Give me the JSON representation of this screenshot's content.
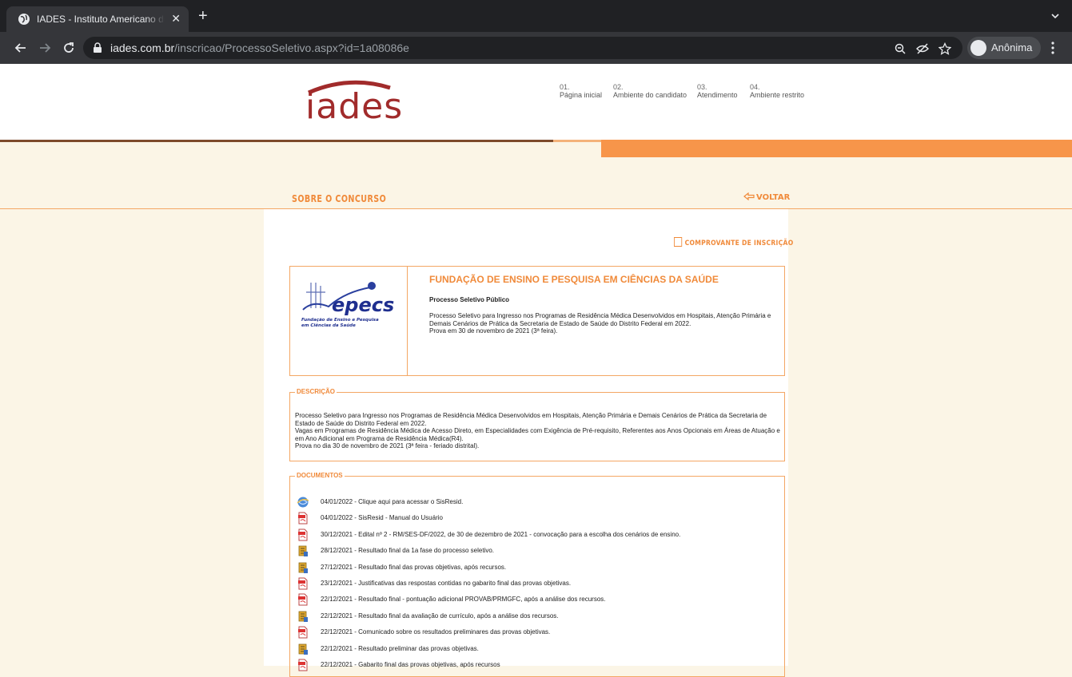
{
  "browser": {
    "tab_title": "IADES - Instituto Americano de",
    "url_domain": "iades.com.br",
    "url_path": "/inscricao/ProcessoSeletivo.aspx?id=1a08086e",
    "profile_name": "Anônima"
  },
  "site": {
    "logo_text": "iades",
    "nav": [
      {
        "num": "01.",
        "label": "Página inicial"
      },
      {
        "num": "02.",
        "label": "Ambiente do candidato"
      },
      {
        "num": "03.",
        "label": "Atendimento"
      },
      {
        "num": "04.",
        "label": "Ambiente restrito"
      }
    ],
    "section_title": "SOBRE O CONCURSO",
    "back_label": "VOLTAR",
    "comprovante_label": "COMPROVANTE DE INSCRIÇÃO"
  },
  "organization": {
    "logo_text": "epecs",
    "logo_subtitle": "Fundação de Ensino e Pesquisa em Ciências da Saúde",
    "title": "FUNDAÇÃO DE ENSINO E PESQUISA EM CIÊNCIAS DA SAÚDE",
    "process_type": "Processo Seletivo Público",
    "process_description": "Processo Seletivo para Ingresso nos Programas de Residência Médica Desenvolvidos em Hospitais, Atenção Primária e Demais Cenários de Prática da Secretaria de Estado de Saúde do Distrito Federal em 2022.\nProva em 30 de novembro de 2021 (3ª feira)."
  },
  "description": {
    "legend": "DESCRIÇÃO",
    "text": "Processo Seletivo para Ingresso nos Programas de Residência Médica Desenvolvidos em Hospitais, Atenção Primária e Demais Cenários de Prática da Secretaria de Estado de Saúde do Distrito Federal em 2022.\nVagas em Programas de Residência Médica de Acesso Direto, em Especialidades com Exigência de Pré-requisito, Referentes aos Anos Opcionais em Áreas de Atuação e em Ano Adicional em Programa de Residência Médica(R4).\nProva no dia 30 de novembro de 2021 (3ª feira - feriado distrital)."
  },
  "documents": {
    "legend": "DOCUMENTOS",
    "items": [
      {
        "icon": "web-link-icon",
        "text": "04/01/2022 - Clique aqui para acessar o SisResid."
      },
      {
        "icon": "pdf-icon",
        "text": "04/01/2022 - SisResid - Manual do Usuário"
      },
      {
        "icon": "pdf-icon",
        "text": "30/12/2021 - Edital nº 2 - RM/SES-DF/2022, de 30 de dezembro de 2021 - convocação para a escolha dos cenários de ensino."
      },
      {
        "icon": "result-icon",
        "text": "28/12/2021 - Resultado final da 1a fase do processo seletivo."
      },
      {
        "icon": "result-icon",
        "text": "27/12/2021 - Resultado final das provas objetivas, após recursos."
      },
      {
        "icon": "pdf-icon",
        "text": "23/12/2021 - Justificativas das respostas contidas no gabarito final das provas objetivas."
      },
      {
        "icon": "pdf-icon",
        "text": "22/12/2021 - Resultado final - pontuação adicional PROVAB/PRMGFC, após a análise dos recursos."
      },
      {
        "icon": "result-icon",
        "text": "22/12/2021 - Resultado final da avaliação de currículo, após a análise dos recursos."
      },
      {
        "icon": "pdf-icon",
        "text": "22/12/2021 - Comunicado sobre os resultados preliminares das provas objetivas."
      },
      {
        "icon": "result-icon",
        "text": "22/12/2021 - Resultado preliminar das provas objetivas."
      },
      {
        "icon": "pdf-icon",
        "text": "22/12/2021 - Gabarito final das provas objetivas, após recursos"
      }
    ]
  },
  "colors": {
    "accent": "#f08a3a",
    "brand_red": "#a12b2b",
    "page_bg": "#fbf5e6"
  }
}
